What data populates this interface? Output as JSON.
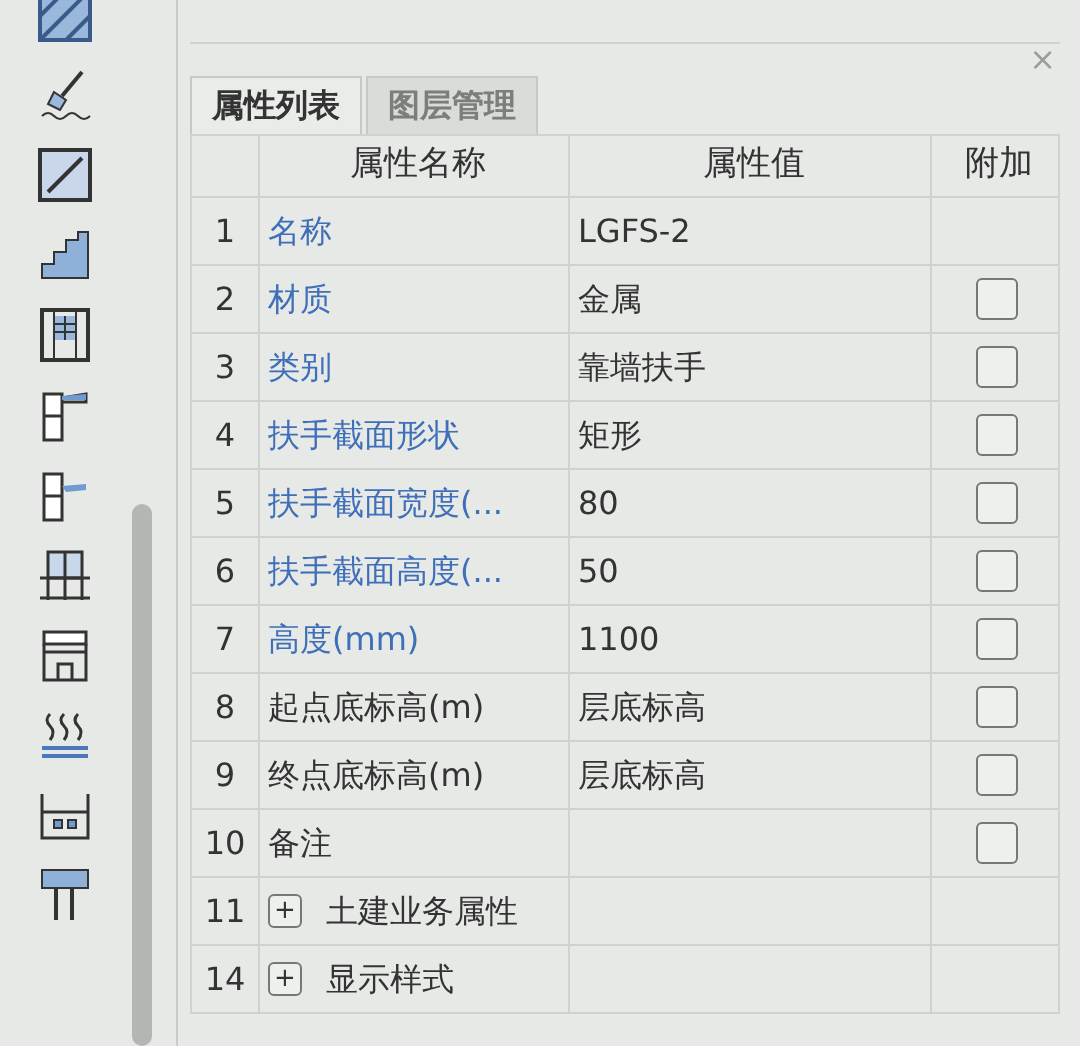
{
  "tabs": [
    {
      "label": "属性列表",
      "selected": true
    },
    {
      "label": "图层管理",
      "selected": false
    }
  ],
  "close": "×",
  "table": {
    "columns": [
      "属性名称",
      "属性值",
      "附加"
    ],
    "rows": [
      {
        "num": "1",
        "name": "名称",
        "value": "LGFS-2",
        "public": true,
        "kind": "field"
      },
      {
        "num": "2",
        "name": "材质",
        "value": "金属",
        "public": true,
        "kind": "field",
        "checked": false
      },
      {
        "num": "3",
        "name": "类别",
        "value": "靠墙扶手",
        "public": true,
        "kind": "field",
        "checked": false
      },
      {
        "num": "4",
        "name": "扶手截面形状",
        "value": "矩形",
        "public": true,
        "kind": "field",
        "checked": false
      },
      {
        "num": "5",
        "name": "扶手截面宽度(...",
        "value": "80",
        "public": true,
        "kind": "field",
        "checked": false
      },
      {
        "num": "6",
        "name": "扶手截面高度(...",
        "value": "50",
        "public": true,
        "kind": "field",
        "checked": false
      },
      {
        "num": "7",
        "name": "高度(mm)",
        "value": "1100",
        "public": true,
        "kind": "field",
        "checked": false
      },
      {
        "num": "8",
        "name": "起点底标高(m)",
        "value": "层底标高",
        "public": false,
        "kind": "field",
        "checked": false
      },
      {
        "num": "9",
        "name": "终点底标高(m)",
        "value": "层底标高",
        "public": false,
        "kind": "field",
        "checked": false
      },
      {
        "num": "10",
        "name": "备注",
        "public": false,
        "kind": "field",
        "checked": false
      },
      {
        "num": "11",
        "name": "土建业务属性",
        "public": false,
        "kind": "group",
        "expanded": false,
        "toggle": "+"
      },
      {
        "num": "14",
        "name": "显示样式",
        "public": false,
        "kind": "group",
        "expanded": false,
        "toggle": "+"
      }
    ]
  }
}
